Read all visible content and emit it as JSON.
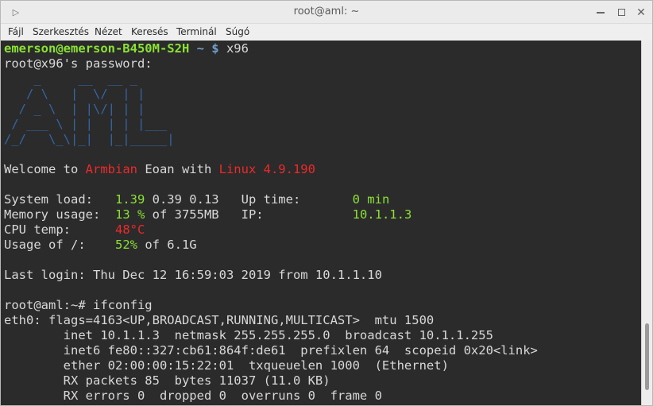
{
  "window": {
    "title": "root@aml: ~",
    "icon": "terminal-icon"
  },
  "menu": [
    "Fájl",
    "Szerkesztés",
    "Nézet",
    "Keresés",
    "Terminál",
    "Súgó"
  ],
  "terminal": {
    "prompt_user": "emerson@emerson-B450M-S2H",
    "prompt_path": " ~ $",
    "command1": " x96",
    "password_line": "root@x96's password:",
    "logo_lines": [
      "    _     __  __ _     ",
      "   / \\   |  \\/  | |    ",
      "  / _ \\  | |\\/| | |    ",
      " / ___ \\ | |  | | |___ ",
      "/_/   \\_\\|_|  |_|_____|"
    ],
    "welcome": {
      "prefix": "Welcome to ",
      "distro": "Armbian",
      "middle": " Eoan with ",
      "kernel": "Linux 4.9.190"
    },
    "sysinfo": {
      "load_label": "System load:   ",
      "load_hi": "1.39",
      "load_rest": " 0.39 0.13",
      "uptime_label": "   Up time:       ",
      "uptime_val": "0 min",
      "mem_label": "Memory usage:  ",
      "mem_val": "13 %",
      "mem_rest": " of 3755MB",
      "ip_label": "   IP:            ",
      "ip_val": "10.1.1.3",
      "cpu_label": "CPU temp:      ",
      "cpu_val": "48°C",
      "usage_label": "Usage of /:    ",
      "usage_val": "52%",
      "usage_rest": " of 6.1G"
    },
    "last_login": "Last login: Thu Dec 12 16:59:03 2019 from 10.1.1.10",
    "prompt2": "root@aml:~# ifconfig",
    "ifconfig": [
      "eth0: flags=4163<UP,BROADCAST,RUNNING,MULTICAST>  mtu 1500",
      "        inet 10.1.1.3  netmask 255.255.255.0  broadcast 10.1.1.255",
      "        inet6 fe80::327:cb61:864f:de61  prefixlen 64  scopeid 0x20<link>",
      "        ether 02:00:00:15:22:01  txqueuelen 1000  (Ethernet)",
      "        RX packets 85  bytes 11037 (11.0 KB)",
      "        RX errors 0  dropped 0  overruns 0  frame 0"
    ]
  },
  "colors": {
    "terminal_bg": "#2b2b2b",
    "green": "#8ae234",
    "blue": "#729fcf",
    "red": "#ef2929",
    "logo_blue": "#3465a4"
  }
}
